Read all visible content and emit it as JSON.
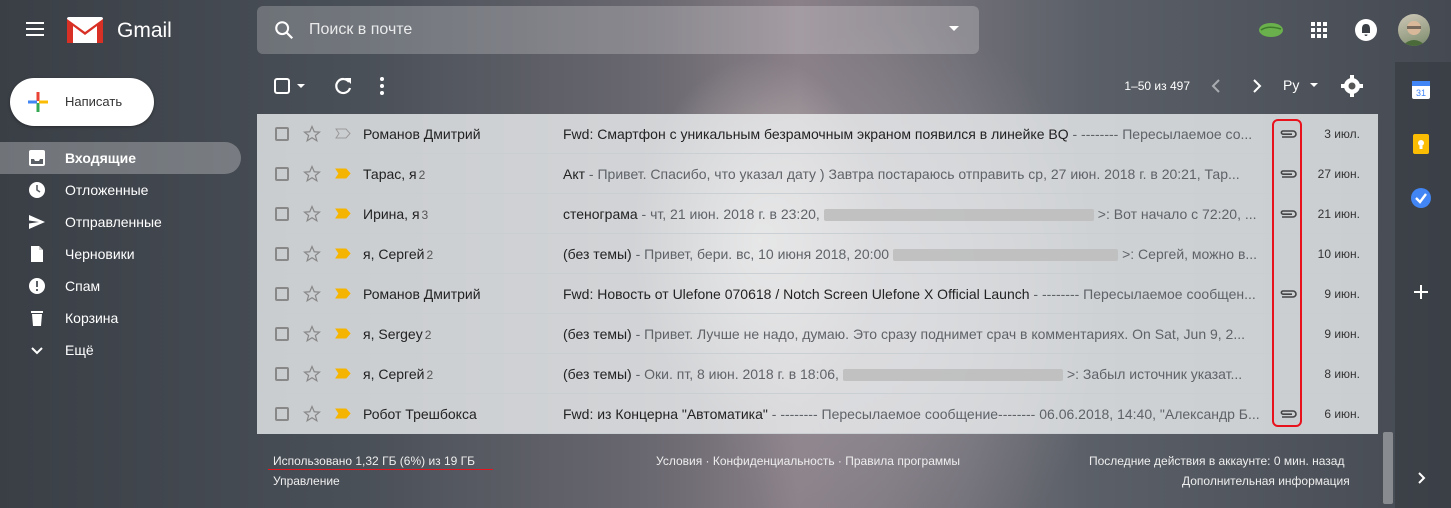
{
  "header": {
    "app_name": "Gmail",
    "search_placeholder": "Поиск в почте"
  },
  "sidebar": {
    "compose_label": "Написать",
    "items": [
      {
        "label": "Входящие",
        "icon": "inbox-icon",
        "active": true
      },
      {
        "label": "Отложенные",
        "icon": "clock-icon"
      },
      {
        "label": "Отправленные",
        "icon": "send-icon"
      },
      {
        "label": "Черновики",
        "icon": "draft-icon"
      },
      {
        "label": "Спам",
        "icon": "spam-icon"
      },
      {
        "label": "Корзина",
        "icon": "trash-icon"
      },
      {
        "label": "Ещё",
        "icon": "chevron-down-icon"
      }
    ]
  },
  "toolbar": {
    "paging": "1–50 из 497",
    "lang": "Ру"
  },
  "emails": [
    {
      "sender": "Романов Дмитрий",
      "count": "",
      "subject": "Fwd: Смартфон с уникальным безрамочным экраном появился в линейке BQ",
      "body": " - -------- Пересылаемое со...",
      "attachment": true,
      "date": "3 июл.",
      "important": false
    },
    {
      "sender": "Тарас, я",
      "count": "2",
      "subject": "Акт",
      "body": " - Привет. Спасибо, что указал дату ) Завтра постараюсь отправить ср, 27 июн. 2018 г. в 20:21, Тар...",
      "attachment": true,
      "date": "27 июн.",
      "important": true
    },
    {
      "sender": "Ирина, я",
      "count": "3",
      "subject": "стенограма",
      "body": " - чт, 21 июн. 2018 г. в 23:20,",
      "body_after": ">: Вот начало с 72:20, ...",
      "blur_width": 270,
      "attachment": true,
      "date": "21 июн.",
      "important": true
    },
    {
      "sender": "я, Сергей",
      "count": "2",
      "subject": "(без темы)",
      "body": " - Привет, бери. вс, 10 июня 2018, 20:00",
      "body_after": ">: Сергей, можно в...",
      "blur_width": 225,
      "attachment": false,
      "date": "10 июн.",
      "important": true
    },
    {
      "sender": "Романов Дмитрий",
      "count": "",
      "subject": "Fwd: Новость от Ulefone 070618 / Notch Screen Ulefone X Official Launch",
      "body": " - -------- Пересылаемое сообщен...",
      "attachment": true,
      "date": "9 июн.",
      "important": true
    },
    {
      "sender": "я, Sergey",
      "count": "2",
      "subject": "(без темы)",
      "body": " - Привет. Лучше не надо, думаю. Это сразу поднимет срач в комментариях. On Sat, Jun 9, 2...",
      "attachment": false,
      "date": "9 июн.",
      "important": true
    },
    {
      "sender": "я, Сергей",
      "count": "2",
      "subject": "(без темы)",
      "body": " - Оки. пт, 8 июн. 2018 г. в 18:06,",
      "body_after": ">: Забыл источник указат...",
      "blur_width": 220,
      "attachment": false,
      "date": "8 июн.",
      "important": true
    },
    {
      "sender": "Робот Трешбокса",
      "count": "",
      "subject": "Fwd: из Концерна \"Автоматика\"",
      "body": " - -------- Пересылаемое сообщение-------- 06.06.2018, 14:40, \"Александр Б...",
      "attachment": true,
      "date": "6 июн.",
      "important": true
    }
  ],
  "footer": {
    "storage": "Использовано 1,32 ГБ (6%) из 19 ГБ",
    "manage": "Управление",
    "links": "Условия · Конфиденциальность · Правила программы",
    "activity": "Последние действия в аккаунте: 0 мин. назад",
    "details": "Дополнительная информация"
  },
  "colors": {
    "highlight": "#e8121d",
    "important": "#f4b400"
  }
}
